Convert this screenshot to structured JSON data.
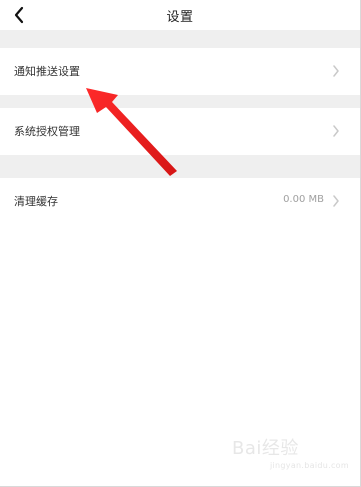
{
  "header": {
    "title": "设置",
    "back_icon": "chevron-left-icon"
  },
  "settings": {
    "items": [
      {
        "label": "通知推送设置",
        "value": "",
        "icon": "chevron-right-icon"
      },
      {
        "label": "系统授权管理",
        "value": "",
        "icon": "chevron-right-icon"
      },
      {
        "label": "清理缓存",
        "value": "0.00 MB",
        "icon": "chevron-right-icon"
      }
    ]
  },
  "overlay": {
    "arrow_color": "#ff1f1f",
    "watermark_text": "Bai经验",
    "watermark_url": "jingyan.baidu.com"
  }
}
